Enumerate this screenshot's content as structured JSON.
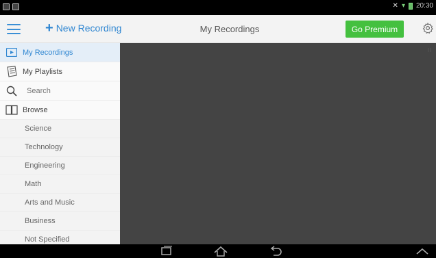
{
  "status_bar": {
    "time": "20:30"
  },
  "header": {
    "new_recording_label": "New Recording",
    "title": "My Recordings",
    "premium_label": "Go Premium"
  },
  "sidebar": {
    "items": [
      {
        "label": "My Recordings",
        "icon": "recording-icon"
      },
      {
        "label": "My Playlists",
        "icon": "playlist-icon"
      }
    ],
    "search_placeholder": "Search",
    "browse_label": "Browse",
    "categories": [
      "Science",
      "Technology",
      "Engineering",
      "Math",
      "Arts and Music",
      "Business",
      "Not Specified"
    ]
  },
  "colors": {
    "accent": "#2f86d1",
    "premium": "#44c03f",
    "content_bg": "#444444"
  }
}
